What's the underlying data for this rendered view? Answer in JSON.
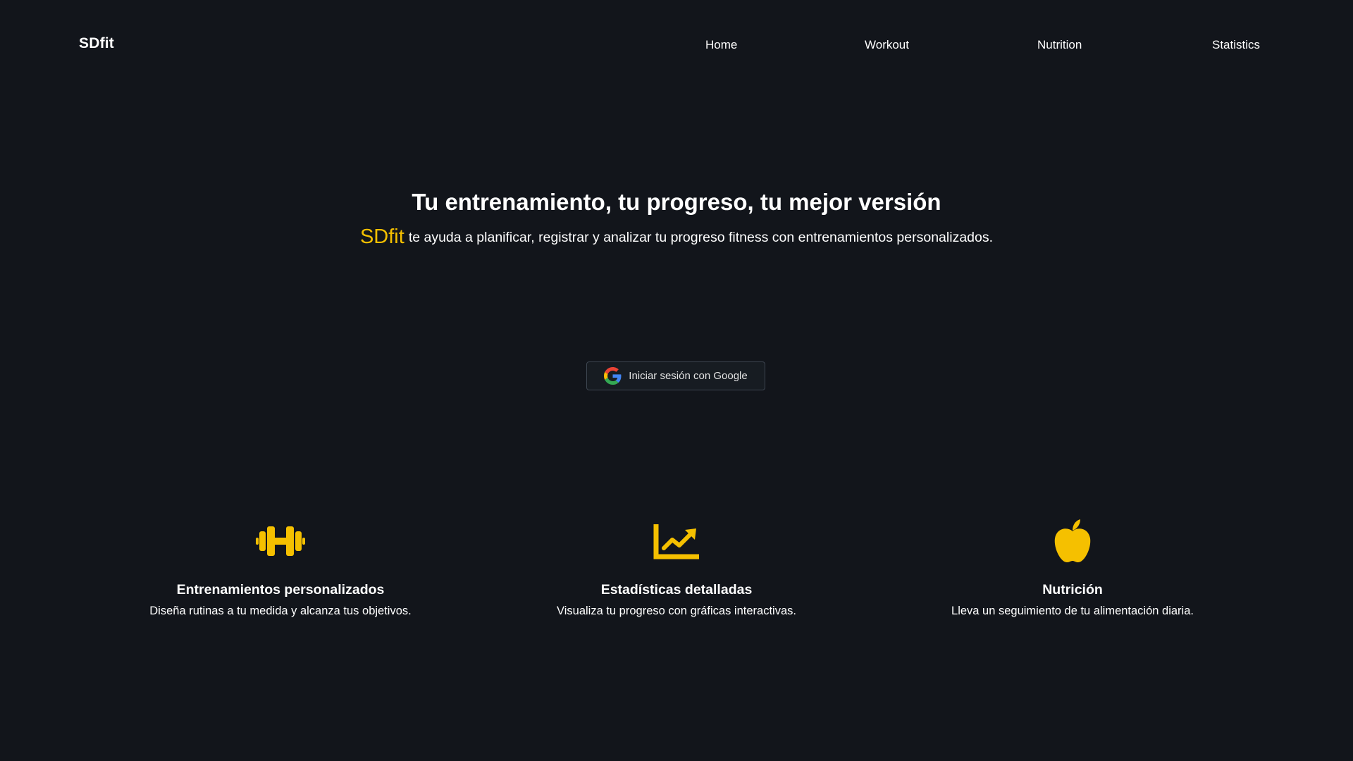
{
  "header": {
    "brand": "SDfit",
    "nav": [
      {
        "label": "Home"
      },
      {
        "label": "Workout"
      },
      {
        "label": "Nutrition"
      },
      {
        "label": "Statistics"
      }
    ]
  },
  "hero": {
    "title": "Tu entrenamiento, tu progreso, tu mejor versión",
    "brand_highlight": "SDfit",
    "subtitle": "te ayuda a planificar, registrar y analizar tu progreso fitness con entrenamientos personalizados."
  },
  "login": {
    "google_button_label": "Iniciar sesión con Google",
    "icon": "google-g-icon"
  },
  "features": [
    {
      "icon": "dumbbell-icon",
      "title": "Entrenamientos personalizados",
      "description": "Diseña rutinas a tu medida y alcanza tus objetivos."
    },
    {
      "icon": "chart-line-icon",
      "title": "Estadísticas detalladas",
      "description": "Visualiza tu progreso con gráficas interactivas."
    },
    {
      "icon": "apple-icon",
      "title": "Nutrición",
      "description": "Lleva un seguimiento de tu alimentación diaria."
    }
  ],
  "colors": {
    "background": "#12151b",
    "accent": "#f5c000",
    "text": "#ffffff",
    "button_border": "#3d4550"
  }
}
